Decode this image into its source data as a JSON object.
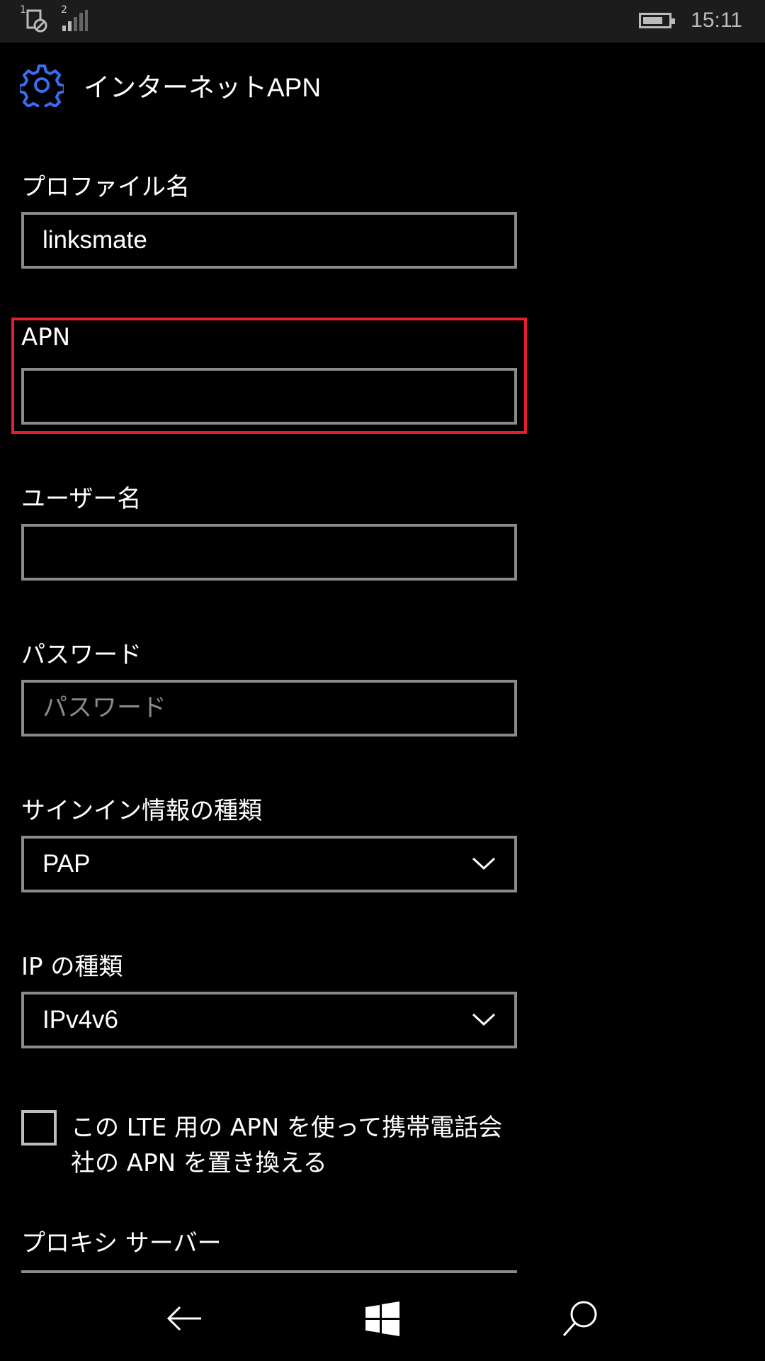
{
  "status_bar": {
    "sim1_label": "1",
    "sim2_label": "2",
    "time": "15:11",
    "battery_level": 0.8
  },
  "header": {
    "icon": "gear-icon",
    "title": "インターネットAPN",
    "accent_color": "#3a6cf0"
  },
  "form": {
    "profile_name": {
      "label": "プロファイル名",
      "value": "linksmate"
    },
    "apn": {
      "label": "APN",
      "value": ""
    },
    "username": {
      "label": "ユーザー名",
      "value": ""
    },
    "password": {
      "label": "パスワード",
      "placeholder": "パスワード"
    },
    "signin_type": {
      "label": "サインイン情報の種類",
      "selected": "PAP"
    },
    "ip_type": {
      "label": "IP の種類",
      "selected": "IPv4v6"
    },
    "replace_apn": {
      "text": "この LTE 用の APN を使って携帯電話会社の APN を置き換える",
      "checked": false
    },
    "proxy_server": {
      "label": "プロキシ サーバー"
    }
  },
  "highlight_color": "#e3202b",
  "nav": {
    "back": "back-arrow-icon",
    "home": "windows-logo-icon",
    "search": "search-icon"
  }
}
